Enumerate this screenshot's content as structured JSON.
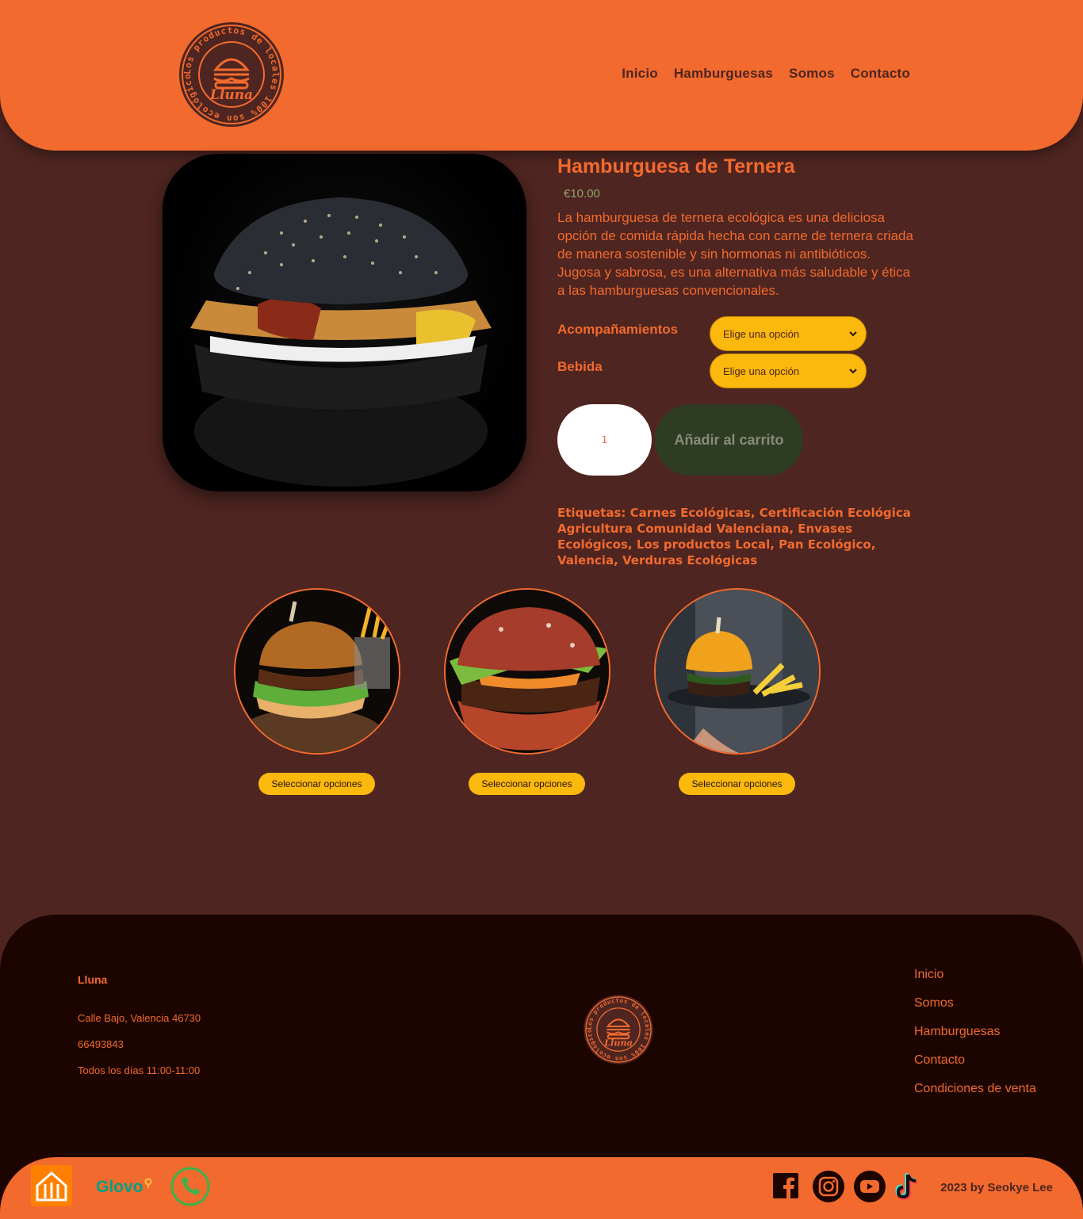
{
  "header": {
    "logo_text": "Lluna",
    "logo_ring_text": "Los productos de locales 100% son ecológicos",
    "nav": [
      "Inicio",
      "Hamburguesas",
      "Somos",
      "Contacto"
    ]
  },
  "product": {
    "title": "Hamburguesa de Ternera",
    "price": "€10.00",
    "description": "La hamburguesa de ternera ecológica es una deliciosa opción de comida rápida hecha con carne de ternera criada de manera sostenible y sin hormonas ni antibióticos. Jugosa y sabrosa, es una alternativa más saludable y ética a las hamburguesas convencionales.",
    "options": [
      {
        "label": "Acompañamientos",
        "selected": "Elige una opción"
      },
      {
        "label": "Bebida",
        "selected": "Elige una opción"
      }
    ],
    "quantity": "1",
    "add_to_cart": "Añadir al carrito",
    "tags_label": "Etiquetas:",
    "tags": [
      "Carnes Ecológicas",
      "Certificación Ecológica Agricultura Comunidad Valenciana",
      "Envases Ecológicos",
      "Los productos Local",
      "Pan Ecológico",
      "Valencia",
      "Verduras Ecológicas"
    ]
  },
  "related": {
    "button_label": "Seleccionar opciones"
  },
  "footer": {
    "brand": "Lluna",
    "address": "Calle Bajo, Valencia 46730",
    "phone": "66493843",
    "hours": "Todos los días 11:00-11:00",
    "links": [
      "Inicio",
      "Somos",
      "Hamburguesas",
      "Contacto",
      "Condiciones de venta"
    ],
    "glovo": "Glovo",
    "copyright": "2023 by Seokye Lee"
  },
  "colors": {
    "orange": "#f26a2e",
    "brown": "#4e2520",
    "yellow": "#fbb80d",
    "dark_green": "#2e3d22",
    "footer_bg": "#1c0400"
  }
}
